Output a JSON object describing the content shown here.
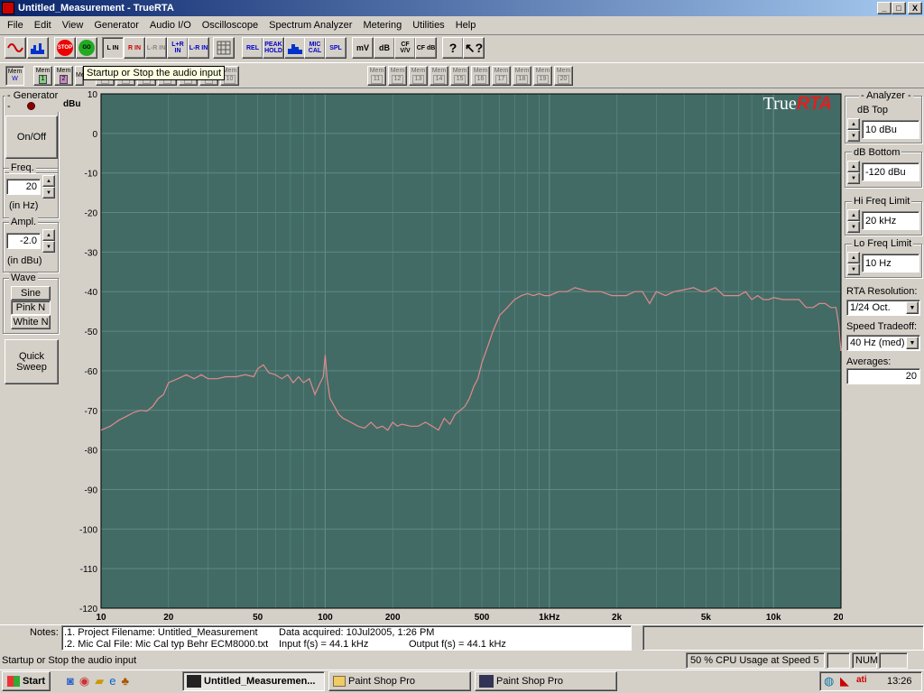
{
  "window": {
    "title": "Untitled_Measurement - TrueRTA",
    "min": "_",
    "max": "□",
    "close": "X"
  },
  "menu": [
    "File",
    "Edit",
    "View",
    "Generator",
    "Audio I/O",
    "Oscilloscope",
    "Spectrum Analyzer",
    "Metering",
    "Utilities",
    "Help"
  ],
  "toolbar": {
    "buttons": [
      "STOP",
      "GO",
      "L IN",
      "R IN",
      "L-R IN",
      "L+R IN",
      "L-R IN",
      "REL",
      "PEAK HOLD",
      "MIC CAL",
      "SPL",
      "mV",
      "dB",
      "CF V/V",
      "CF dB"
    ],
    "tooltip": "Startup or Stop the audio input",
    "mem_labels": {
      "w": "W",
      "prefix": "Mem"
    },
    "mem": [
      "1",
      "2",
      "3",
      "4",
      "5",
      "6",
      "7",
      "8",
      "9",
      "10",
      "11",
      "12",
      "13",
      "14",
      "15",
      "16",
      "17",
      "18",
      "19",
      "20"
    ]
  },
  "generator": {
    "title": "Generator",
    "onoff": "On/Off",
    "freq_label": "Freq.",
    "freq_value": "20",
    "freq_unit": "(in Hz)",
    "ampl_label": "Ampl.",
    "ampl_value": "-2.0",
    "ampl_unit": "(in dBu)",
    "wave_label": "Wave",
    "waves": [
      "Sine",
      "Pink N",
      "White N"
    ],
    "quick_sweep": "Quick Sweep"
  },
  "analyzer": {
    "title": "Analyzer",
    "db_top_label": "dB Top",
    "db_top": "10 dBu",
    "db_bottom_label": "dB Bottom",
    "db_bottom": "-120 dBu",
    "hi_freq_label": "Hi Freq Limit",
    "hi_freq": "20 kHz",
    "lo_freq_label": "Lo Freq Limit",
    "lo_freq": "10 Hz",
    "rta_res_label": "RTA Resolution:",
    "rta_res": "1/24 Oct.",
    "speed_label": "Speed Tradeoff:",
    "speed": "40 Hz (med)",
    "averages_label": "Averages:",
    "averages": "20"
  },
  "chart_data": {
    "type": "line",
    "logo": {
      "true": "True",
      "rta": "RTA"
    },
    "ylabel": "dBu",
    "yticks": [
      10,
      0,
      -10,
      -20,
      -30,
      -40,
      -50,
      -60,
      -70,
      -80,
      -90,
      -100,
      -110,
      -120
    ],
    "ylim": [
      -120,
      10
    ],
    "xlim": [
      10,
      20000
    ],
    "x_scale": "log",
    "xticks": [
      {
        "v": 10,
        "l": "10"
      },
      {
        "v": 20,
        "l": "20"
      },
      {
        "v": 50,
        "l": "50"
      },
      {
        "v": 100,
        "l": "100"
      },
      {
        "v": 200,
        "l": "200"
      },
      {
        "v": 500,
        "l": "500"
      },
      {
        "v": 1000,
        "l": "1kHz"
      },
      {
        "v": 2000,
        "l": "2k"
      },
      {
        "v": 5000,
        "l": "5k"
      },
      {
        "v": 10000,
        "l": "10k"
      },
      {
        "v": 20000,
        "l": "20k"
      }
    ],
    "colors": {
      "bg": "#426b66",
      "grid": "#5f8a84",
      "line": "#e08a8a"
    },
    "series": [
      {
        "x": [
          10,
          11,
          12,
          13,
          14,
          15,
          16,
          17,
          18,
          19,
          20,
          22,
          24,
          26,
          28,
          30,
          33,
          36,
          40,
          44,
          48,
          50,
          53,
          56,
          60,
          64,
          68,
          72,
          76,
          80,
          85,
          90,
          95,
          98,
          100,
          102,
          105,
          110,
          115,
          120,
          130,
          140,
          150,
          160,
          170,
          180,
          190,
          200,
          210,
          220,
          240,
          260,
          280,
          300,
          320,
          340,
          360,
          380,
          400,
          420,
          440,
          460,
          480,
          500,
          530,
          560,
          600,
          650,
          700,
          750,
          800,
          850,
          900,
          950,
          1000,
          1100,
          1200,
          1300,
          1400,
          1500,
          1600,
          1700,
          1800,
          1900,
          2000,
          2200,
          2400,
          2600,
          2800,
          3000,
          3300,
          3600,
          4000,
          4400,
          4800,
          5000,
          5500,
          6000,
          6500,
          7000,
          7500,
          8000,
          8500,
          9000,
          9500,
          10000,
          11000,
          12000,
          13000,
          14000,
          15000,
          16000,
          17000,
          18000,
          19000,
          19500,
          20000
        ],
        "y": [
          -75,
          -74,
          -72.5,
          -71.5,
          -70.5,
          -70,
          -70.2,
          -69,
          -67,
          -66,
          -63,
          -62,
          -61,
          -62,
          -61,
          -62,
          -62,
          -61.5,
          -61.5,
          -61,
          -61.5,
          -59.5,
          -58.5,
          -60.5,
          -61,
          -62,
          -61,
          -63,
          -61.5,
          -63,
          -62,
          -66,
          -63,
          -61.5,
          -56,
          -62,
          -67,
          -69,
          -71,
          -72,
          -73,
          -74,
          -74.5,
          -73,
          -74.5,
          -74,
          -75,
          -73,
          -74,
          -73.5,
          -74,
          -74,
          -73,
          -74,
          -75,
          -72,
          -73.5,
          -71,
          -70,
          -69,
          -67,
          -64,
          -62,
          -58,
          -54,
          -50,
          -46,
          -44,
          -42,
          -41,
          -40.5,
          -41,
          -40.5,
          -41,
          -41,
          -40,
          -40,
          -39,
          -39.5,
          -40,
          -40,
          -40,
          -40.5,
          -41,
          -41,
          -41,
          -40,
          -40,
          -43,
          -40,
          -41,
          -40,
          -39.5,
          -39,
          -40,
          -40,
          -39,
          -41,
          -41,
          -41,
          -40,
          -42,
          -41,
          -42,
          -42,
          -41.5,
          -42,
          -42,
          -42,
          -44,
          -44,
          -43,
          -43,
          -44,
          -44,
          -48,
          -55
        ]
      }
    ]
  },
  "notes": {
    "label": "Notes:",
    "line1": ".1. Project Filename: Untitled_Measurement",
    "line2": ".2. Mic Cal File: Mic Cal typ Behr ECM8000.txt",
    "acq": "Data acquired: 10Jul2005, 1:26 PM",
    "input": "Input f(s) = 44.1 kHz",
    "output": "Output f(s) = 44.1 kHz"
  },
  "status": {
    "text": "Startup or Stop the audio input",
    "cpu": "50 % CPU Usage at Speed 5",
    "num": "NUM"
  },
  "taskbar": {
    "start": "Start",
    "tasks": [
      "Untitled_Measuremen...",
      "Paint Shop Pro",
      "Paint Shop Pro"
    ],
    "clock": "13:26"
  }
}
